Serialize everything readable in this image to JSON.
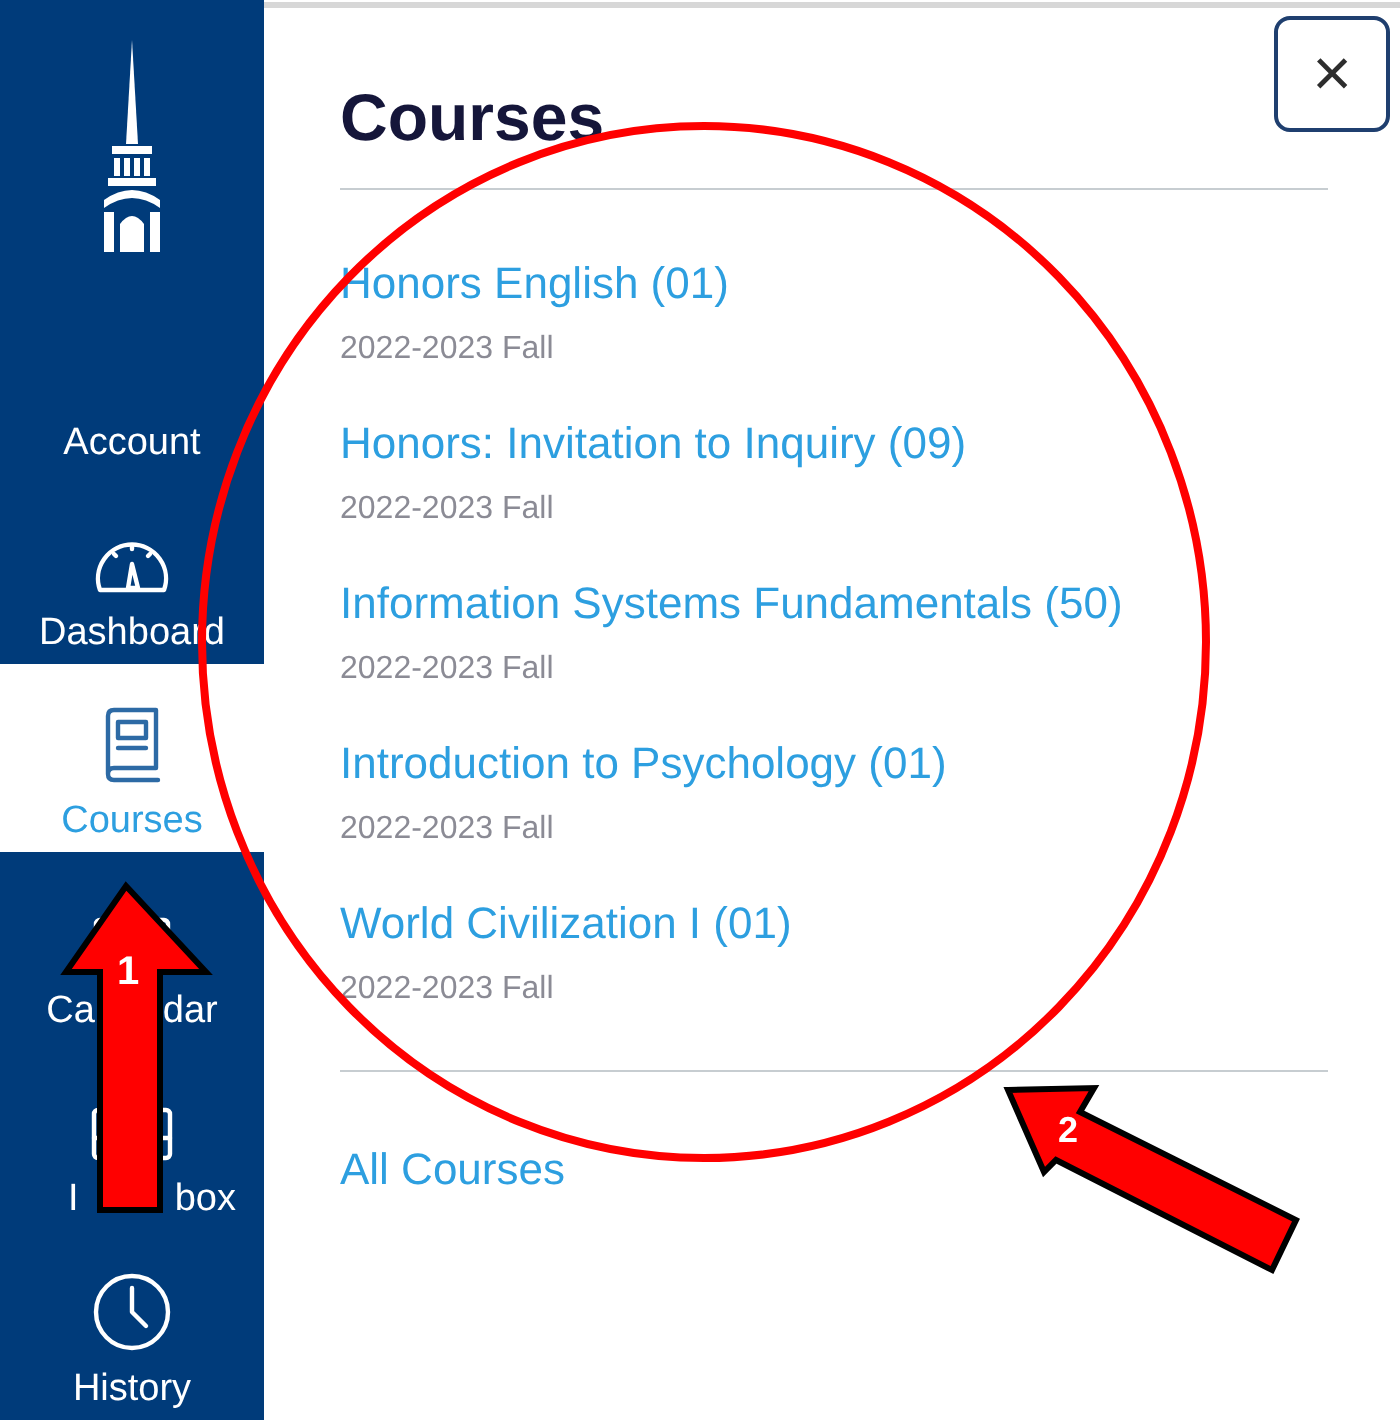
{
  "sidebar": {
    "items": [
      {
        "kind": "account",
        "label": "Account",
        "selected": false
      },
      {
        "kind": "dashboard",
        "label": "Dashboard",
        "selected": false
      },
      {
        "kind": "courses",
        "label": "Courses",
        "selected": true
      },
      {
        "kind": "calendar",
        "label_parts": [
          "Ca",
          "dar"
        ],
        "selected": false
      },
      {
        "kind": "inbox",
        "label_parts": [
          "I",
          "box"
        ],
        "selected": false
      },
      {
        "kind": "history",
        "label": "History",
        "selected": false
      }
    ]
  },
  "tray": {
    "title": "Courses",
    "close": "×",
    "courses": [
      {
        "name": "Honors English (01)",
        "term": "2022-2023 Fall"
      },
      {
        "name": "Honors: Invitation to Inquiry (09)",
        "term": "2022-2023 Fall"
      },
      {
        "name": "Information Systems Fundamentals (50)",
        "term": "2022-2023 Fall"
      },
      {
        "name": "Introduction to Psychology (01)",
        "term": "2022-2023 Fall"
      },
      {
        "name": "World Civilization I (01)",
        "term": "2022-2023 Fall"
      }
    ],
    "all_courses": "All Courses"
  },
  "annotations": {
    "markers": [
      {
        "number": "1"
      },
      {
        "number": "2"
      }
    ]
  }
}
